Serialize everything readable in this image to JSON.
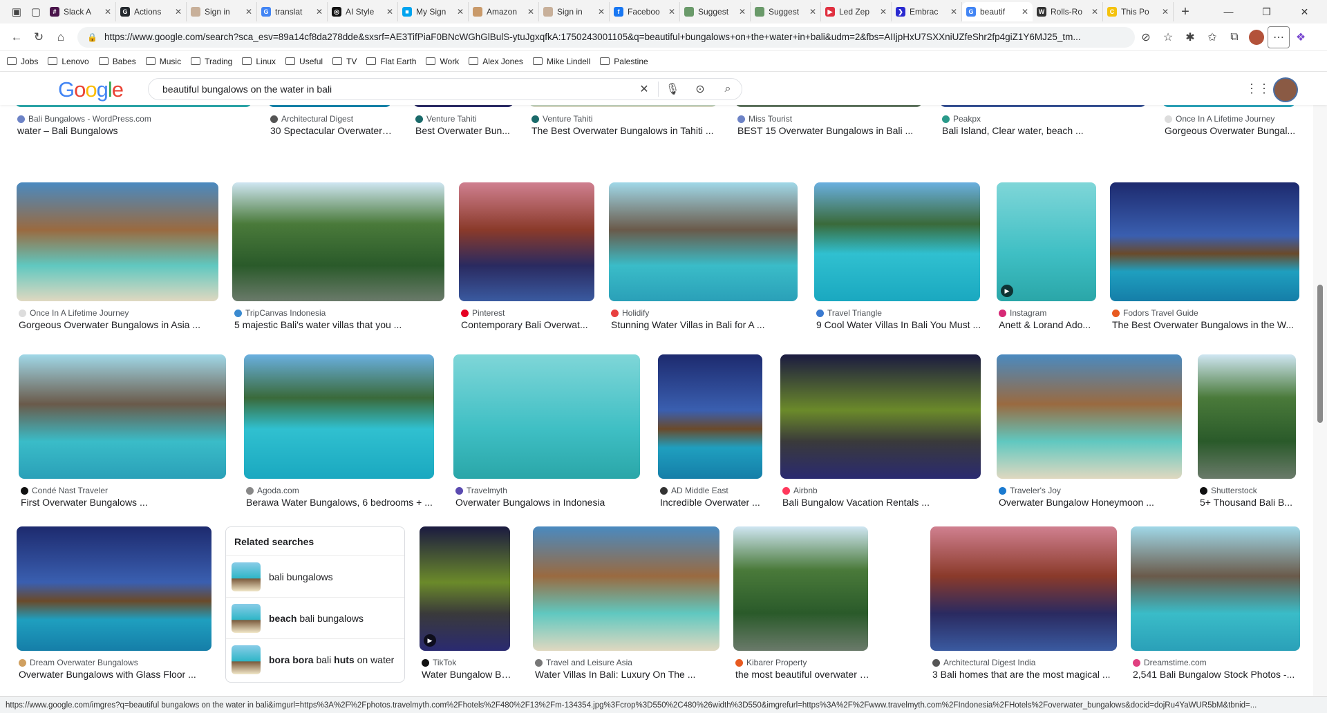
{
  "tabs": [
    {
      "label": "Slack A",
      "fav": "#4a154b",
      "letter": "#"
    },
    {
      "label": "Actions",
      "fav": "#24292e",
      "letter": "G"
    },
    {
      "label": "Sign in",
      "fav": "#c8b09a",
      "letter": ""
    },
    {
      "label": "translat",
      "fav": "#4285f4",
      "letter": "G"
    },
    {
      "label": "AI Style",
      "fav": "#111111",
      "letter": "◎"
    },
    {
      "label": "My Sign",
      "fav": "#00a4ef",
      "letter": "■"
    },
    {
      "label": "Amazon",
      "fav": "#c99a6a",
      "letter": ""
    },
    {
      "label": "Sign in",
      "fav": "#c8b09a",
      "letter": ""
    },
    {
      "label": "Faceboo",
      "fav": "#1877f2",
      "letter": "f"
    },
    {
      "label": "Suggest",
      "fav": "#6a9a6a",
      "letter": ""
    },
    {
      "label": "Suggest",
      "fav": "#6a9a6a",
      "letter": ""
    },
    {
      "label": "Led Zep",
      "fav": "#e03040",
      "letter": "▶"
    },
    {
      "label": "Embrac",
      "fav": "#2a2ad0",
      "letter": "❯"
    },
    {
      "label": "beautif",
      "fav": "#4285f4",
      "letter": "G",
      "active": true
    },
    {
      "label": "Rolls-Ro",
      "fav": "#333333",
      "letter": "W"
    },
    {
      "label": "This Po",
      "fav": "#f4c20d",
      "letter": "C"
    }
  ],
  "url": "https://www.google.com/search?sca_esv=89a14cf8da278dde&sxsrf=AE3TifPiaF0BNcWGhGlBulS-ytuJgxqfkA:1750243001105&q=beautiful+bungalows+on+the+water+in+bali&udm=2&fbs=AIIjpHxU7SXXniUZfeShr2fp4giZ1Y6MJ25_tm...",
  "bookmarks": [
    "Jobs",
    "Lenovo",
    "Babes",
    "Music",
    "Trading",
    "Linux",
    "Useful",
    "TV",
    "Flat Earth",
    "Work",
    "Alex Jones",
    "Mike Lindell",
    "Palestine"
  ],
  "search": {
    "logo": "Google",
    "query": "beautiful bungalows on the water in bali"
  },
  "row0": [
    {
      "source": "Bali Bungalows - WordPress.com",
      "title": "water – Bali Bungalows",
      "c": "#6d83c6"
    },
    {
      "source": "Architectural Digest",
      "title": "30 Spectacular Overwater B...",
      "c": "#555"
    },
    {
      "source": "Venture Tahiti",
      "title": "Best Overwater Bun...",
      "c": "#1a6a6a"
    },
    {
      "source": "Venture Tahiti",
      "title": "The Best Overwater Bungalows in Tahiti ...",
      "c": "#1a6a6a"
    },
    {
      "source": "Miss Tourist",
      "title": "BEST 15 Overwater Bungalows in Bali ...",
      "c": "#6d83c6"
    },
    {
      "source": "Peakpx",
      "title": "Bali Island, Clear water, beach ...",
      "c": "#2a9a8a"
    },
    {
      "source": "Once In A Lifetime Journey",
      "title": "Gorgeous Overwater Bungal...",
      "c": "#ddd"
    }
  ],
  "row1": [
    {
      "source": "Once In A Lifetime Journey",
      "title": "Gorgeous Overwater Bungalows in Asia ...",
      "c": "#ddd"
    },
    {
      "source": "TripCanvas Indonesia",
      "title": "5 majestic Bali's water villas that you ...",
      "c": "#3a8ad0"
    },
    {
      "source": "Pinterest",
      "title": "Contemporary Bali Overwat...",
      "c": "#e60023"
    },
    {
      "source": "Holidify",
      "title": "Stunning Water Villas in Bali for A ...",
      "c": "#e84040"
    },
    {
      "source": "Travel Triangle",
      "title": "9 Cool Water Villas In Bali You Must ...",
      "c": "#3a7ad0"
    },
    {
      "source": "Instagram",
      "title": "Anett & Lorand Ado...",
      "c": "#d62976"
    },
    {
      "source": "Fodors Travel Guide",
      "title": "The Best Overwater Bungalows in the W...",
      "c": "#e85a20"
    }
  ],
  "row2": [
    {
      "source": "Condé Nast Traveler",
      "title": "First Overwater Bungalows ...",
      "c": "#111"
    },
    {
      "source": "Agoda.com",
      "title": "Berawa Water Bungalows, 6 bedrooms + ...",
      "c": "#888"
    },
    {
      "source": "Travelmyth",
      "title": "Overwater Bungalows in Indonesia",
      "c": "#5a4ab0"
    },
    {
      "source": "AD Middle East",
      "title": "Incredible Overwater ...",
      "c": "#333"
    },
    {
      "source": "Airbnb",
      "title": "Bali Bungalow Vacation Rentals ...",
      "c": "#ff385c"
    },
    {
      "source": "Traveler's Joy",
      "title": "Overwater Bungalow Honeymoon ...",
      "c": "#1a7ad0"
    },
    {
      "source": "Shutterstock",
      "title": "5+ Thousand Bali B...",
      "c": "#111"
    }
  ],
  "row3": [
    {
      "source": "Dream Overwater Bungalows",
      "title": "Overwater Bungalows with Glass Floor ...",
      "c": "#d0a060"
    },
    {
      "source": "TikTok",
      "title": "Water Bungalow Ba...",
      "c": "#111"
    },
    {
      "source": "Travel and Leisure Asia",
      "title": "Water Villas In Bali: Luxury On The ...",
      "c": "#777"
    },
    {
      "source": "Kibarer Property",
      "title": "the most beautiful overwater bungalo...",
      "c": "#e85a20"
    },
    {
      "source": "Architectural Digest India",
      "title": "3 Bali homes that are the most magical ...",
      "c": "#555"
    },
    {
      "source": "Dreamstime.com",
      "title": "2,541 Bali Bungalow Stock Photos -...",
      "c": "#e04080"
    }
  ],
  "related": {
    "heading": "Related searches",
    "items": [
      {
        "bold": "",
        "rest": "bali bungalows"
      },
      {
        "bold": "beach",
        "rest": " bali bungalows"
      },
      {
        "bold": "bora bora",
        "rest": " bali ",
        "bold2": "huts",
        "rest2": " on water"
      }
    ]
  },
  "status": "https://www.google.com/imgres?q=beautiful bungalows on the water in bali&imgurl=https%3A%2F%2Fphotos.travelmyth.com%2Fhotels%2F480%2F13%2Fm-134354.jpg%3Fcrop%3D550%2C480%26width%3D550&imgrefurl=https%3A%2F%2Fwww.travelmyth.com%2FIndonesia%2FHotels%2Foverwater_bungalows&docid=dojRu4YaWUR5bM&tbnid=..."
}
